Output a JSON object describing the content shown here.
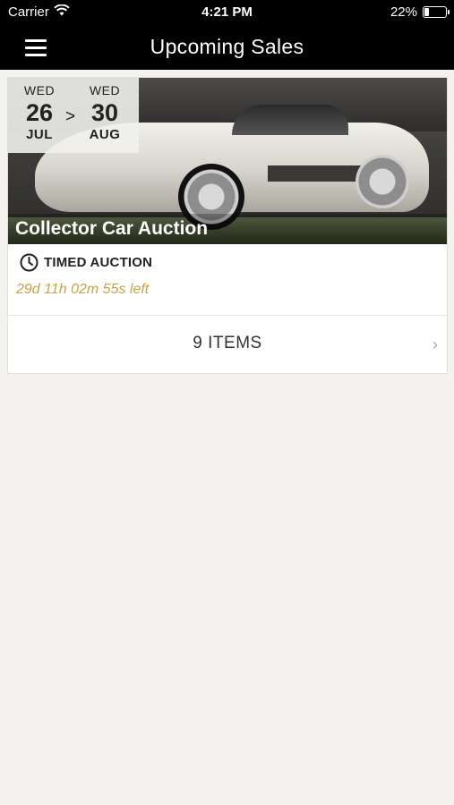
{
  "status_bar": {
    "carrier": "Carrier",
    "time": "4:21 PM",
    "battery_text": "22%",
    "battery_level": 0.22
  },
  "nav": {
    "title": "Upcoming Sales",
    "menu_icon": "hamburger-menu-icon"
  },
  "sale": {
    "start": {
      "weekday": "WED",
      "day": "26",
      "month": "JUL"
    },
    "arrow": ">",
    "end": {
      "weekday": "WED",
      "day": "30",
      "month": "AUG"
    },
    "title": "Collector Car Auction",
    "type_label": "TIMED AUCTION",
    "time_left": "29d 11h 02m 55s left",
    "items_label": "9 ITEMS",
    "chevron": "›"
  },
  "colors": {
    "accent_gold": "#c9a247",
    "nav_background": "#000000",
    "page_background": "#f3f2ee"
  }
}
